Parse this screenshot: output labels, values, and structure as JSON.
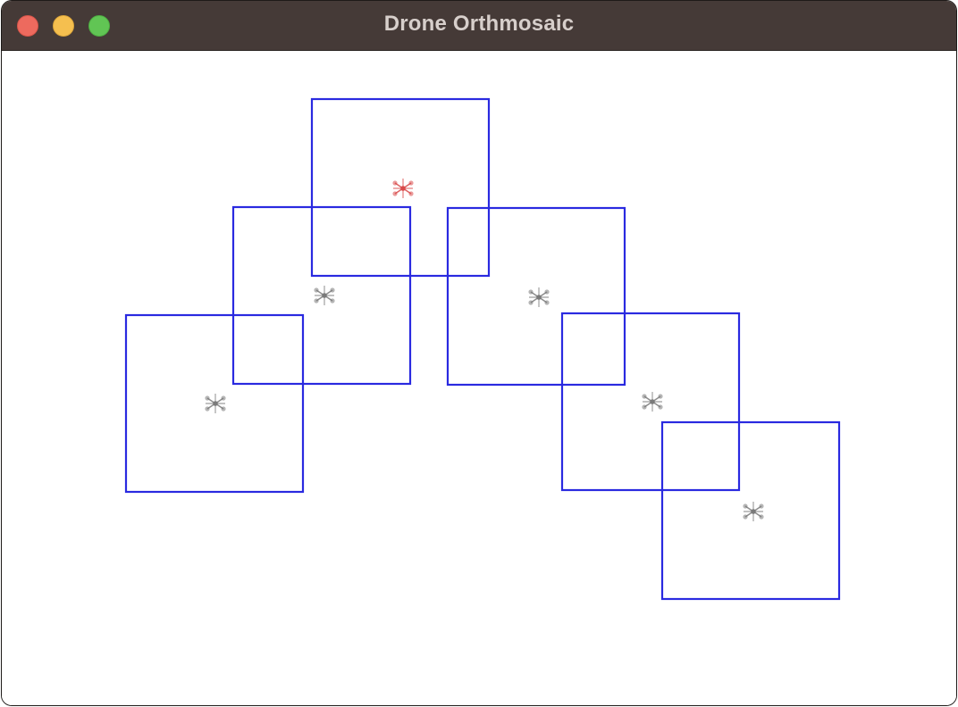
{
  "window": {
    "title": "Drone Orthmosaic",
    "controls": [
      {
        "name": "close",
        "color": "#ed6a5e"
      },
      {
        "name": "minimize",
        "color": "#f5bf4f"
      },
      {
        "name": "zoom",
        "color": "#61c554"
      }
    ]
  },
  "canvas": {
    "background": "#ffffff",
    "footprint_color": "#2a2ae0",
    "drone_icon": "quadcopter-icon",
    "drone_color": "#7a7a7a",
    "active_drone_color": "#d94a4a",
    "footprint_count": 6,
    "drone_count": 6,
    "active_drone_index": 5
  }
}
